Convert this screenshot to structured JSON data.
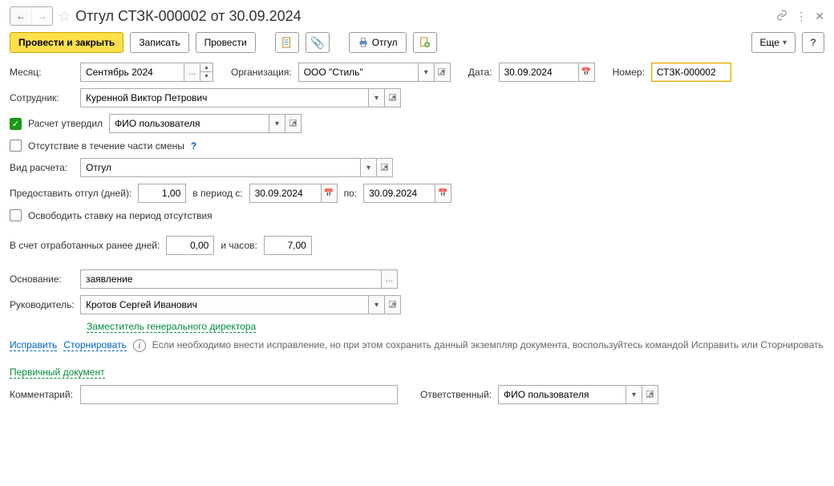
{
  "title": "Отгул СТЗК-000002 от 30.09.2024",
  "toolbar": {
    "post_close": "Провести и закрыть",
    "save": "Записать",
    "post": "Провести",
    "print": "Отгул",
    "more": "Еще",
    "help": "?"
  },
  "labels": {
    "month": "Месяц:",
    "org": "Организация:",
    "date": "Дата:",
    "number": "Номер:",
    "employee": "Сотрудник:",
    "calc_approved": "Расчет утвердил",
    "partial_absence": "Отсутствие в течение части смены",
    "calc_type": "Вид расчета:",
    "grant_days": "Предоставить отгул (дней):",
    "period_from": "в период с:",
    "period_to": "по:",
    "release_rate": "Освободить ставку на период отсутствия",
    "worked_days": "В счет отработанных ранее дней:",
    "and_hours": "и часов:",
    "reason": "Основание:",
    "manager": "Руководитель:",
    "manager_position": "Заместитель генерального директора",
    "correct": "Исправить",
    "reverse": "Сторнировать",
    "info_text": "Если необходимо внести исправление, но при этом сохранить данный экземпляр документа, воспользуйтесь командой Исправить или Сторнировать",
    "primary_doc": "Первичный документ",
    "comment": "Комментарий:",
    "responsible": "Ответственный:"
  },
  "values": {
    "month": "Сентябрь 2024",
    "org": "ООО \"Стиль\"",
    "date": "30.09.2024",
    "number": "СТЗК-000002",
    "employee": "Куренной Виктор Петрович",
    "approver": "ФИО пользователя",
    "calc_type": "Отгул",
    "grant_days": "1,00",
    "period_from": "30.09.2024",
    "period_to": "30.09.2024",
    "worked_days": "0,00",
    "worked_hours": "7,00",
    "reason": "заявление",
    "manager": "Кротов Сергей Иванович",
    "comment": "",
    "responsible": "ФИО пользователя"
  },
  "checks": {
    "calc_approved": true,
    "partial_absence": false,
    "release_rate": false
  }
}
